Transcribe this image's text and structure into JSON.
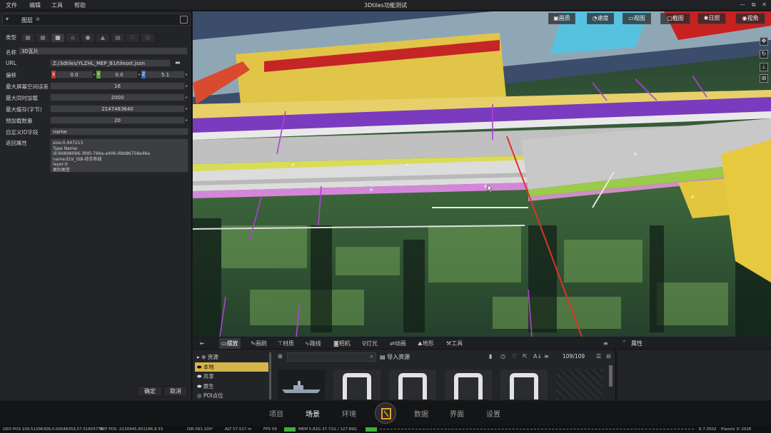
{
  "window": {
    "title": "3Dtiles功能测试",
    "menu": [
      "文件",
      "编辑",
      "工具",
      "帮助"
    ],
    "controls": [
      "—",
      "⧉",
      "✕"
    ]
  },
  "layer_panel": {
    "title": "图层",
    "labels": {
      "type": "类型",
      "name": "名称",
      "url": "URL",
      "offset": "偏移",
      "max_sse": "最大屏幕空间误差",
      "max_concurrent": "最大同时加载",
      "max_cache": "最大缓存(字节)",
      "preload": "预加载数量",
      "custom_id": "自定义ID字段",
      "return_attr": "返回属性"
    },
    "type_icons": [
      "grid-small-icon",
      "grid-icon",
      "grid-large-icon",
      "building-icon",
      "pin-icon",
      "terrain-icon",
      "tiles-icon",
      "dots-icon",
      "cube-icon"
    ],
    "name": "3D瓦片",
    "url": "Z:/3dtiles/YLZHL_MEP_B1/tileset.json",
    "offset": {
      "x_label": "X",
      "x": "0.0",
      "y_label": "Y",
      "y": "0.0",
      "z_label": "Z",
      "z": "5.1"
    },
    "max_sse": "16",
    "max_concurrent": "2000",
    "max_cache": "2147483640",
    "preload": "20",
    "custom_id": "name",
    "return_attr": [
      "size:0.447213",
      "Type Name:",
      "id:66898096-3fd0-794a-a406-0bb86758a46a",
      "name:ELV_ISB-综合布线",
      "layer:0",
      "类别类型"
    ],
    "ok": "确定",
    "cancel": "取消"
  },
  "viewport_toolbar": [
    {
      "icon": "image-quality-icon",
      "label": "画质"
    },
    {
      "icon": "speed-icon",
      "label": "速度"
    },
    {
      "icon": "view-icon",
      "label": "视图"
    },
    {
      "icon": "screenshot-icon",
      "label": "截图"
    },
    {
      "icon": "sun-icon",
      "label": "日照"
    },
    {
      "icon": "eye-icon",
      "label": "视角"
    }
  ],
  "viewport_side": [
    "move-icon",
    "rotate-icon",
    "align-icon",
    "grid-icon"
  ],
  "resource_tabs": [
    {
      "label": "摆放",
      "selected": true
    },
    {
      "label": "画刷"
    },
    {
      "label": "材质"
    },
    {
      "label": "路线"
    },
    {
      "label": "相机"
    },
    {
      "label": "灯光"
    },
    {
      "label": "动画"
    },
    {
      "label": "地形"
    },
    {
      "label": "工具"
    }
  ],
  "resource_tree": [
    {
      "label": "资源",
      "icon": "plus-circle-icon"
    },
    {
      "label": "本地",
      "icon": "local-icon",
      "selected": true
    },
    {
      "label": "共享",
      "icon": "share-icon"
    },
    {
      "label": "原生",
      "icon": "native-icon"
    },
    {
      "label": "POI点位",
      "icon": "poi-icon"
    }
  ],
  "resource_toolbar": {
    "import": "导入资源",
    "count": "109/109"
  },
  "properties": {
    "title": "属性"
  },
  "navbar": [
    {
      "label": "项目"
    },
    {
      "label": "场景",
      "selected": true
    },
    {
      "label": "环境"
    },
    {
      "label": "数据"
    },
    {
      "label": "界面"
    },
    {
      "label": "设置"
    }
  ],
  "status": {
    "geo_pos": "GEO POS  109.51296306,0.00048359,57.51655776",
    "ref_pos": "REF POS  -2130445.601186,8.53",
    "dir": "DIR  091.100°",
    "alt": "ALT   57.517 m",
    "fps": "FPS   59",
    "mem": "MEM   5.82G   37.71G / 127.89G",
    "version": "6.7.3502",
    "brand": "Piaoshi © 2026"
  },
  "colors": {
    "accent": "#d5b44a",
    "panel": "#232427",
    "navbar": "#141517"
  }
}
